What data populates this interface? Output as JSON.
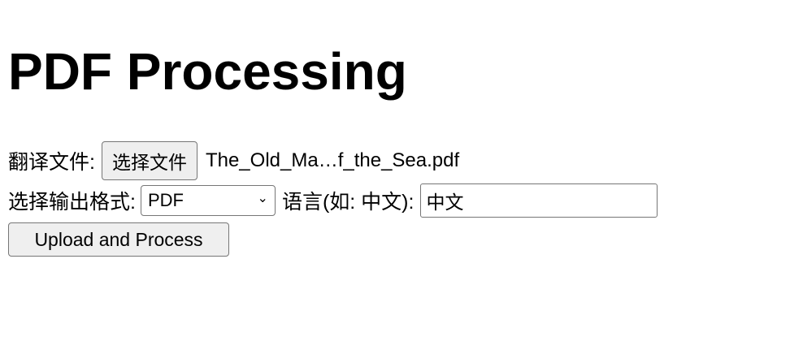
{
  "page_title": "PDF Processing",
  "form": {
    "file_label": "翻译文件:",
    "file_button": "选择文件",
    "file_name": "The_Old_Ma…f_the_Sea.pdf",
    "format_label": "选择输出格式:",
    "format_value": "PDF",
    "language_label": "语言(如: 中文):",
    "language_value": "中文",
    "submit_label": "Upload and Process"
  }
}
